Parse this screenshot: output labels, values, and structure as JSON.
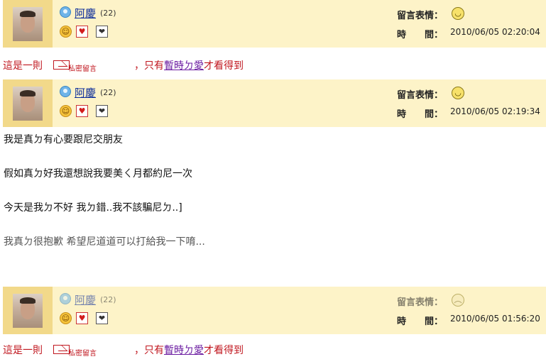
{
  "private_notice": {
    "prefix": "這是一則",
    "private_label": "私密留言",
    "middle": "，只有",
    "link": "暫時ㄉ愛",
    "suffix": "才看得到"
  },
  "labels": {
    "mood": "留言表情：",
    "time": "時　　間："
  },
  "posts": [
    {
      "user": "阿慶",
      "age": "(22)",
      "time": "2010/06/05 02:20:04",
      "mood_icon": "grin-face-icon"
    },
    {
      "user": "阿慶",
      "age": "(22)",
      "time": "2010/06/05 02:19:34",
      "mood_icon": "grin-face-icon",
      "message": [
        "我是真ㄉ有心要跟尼交朋友",
        "假如真ㄉ好我還想說我要美ㄑ月都約尼一次",
        "今天是我ㄉ不好 我ㄉ錯..我不該騙尼ㄉ..]",
        "我真ㄉ很抱歉 希望尼道道可以打給我一下唷..."
      ]
    },
    {
      "user": "阿慶",
      "age": "(22)",
      "time": "2010/06/05 01:56:20",
      "mood_icon": "sad-face-icon"
    }
  ],
  "colors": {
    "header_bg": "#fdf3c8",
    "avatar_bg": "#f2d98a",
    "notice_red": "#c0161e",
    "link_purple": "#6a1aa0"
  }
}
